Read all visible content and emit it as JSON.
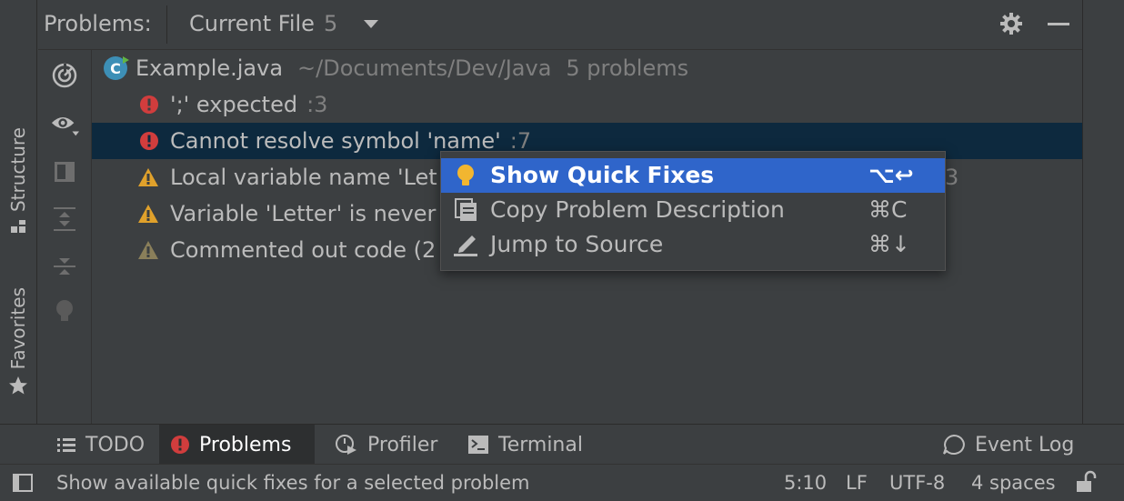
{
  "left_stripe": {
    "structure_label": "Structure",
    "favorites_label": "Favorites"
  },
  "header": {
    "title": "Problems:",
    "scope_label": "Current File",
    "scope_count": "5",
    "settings_icon": "gear-icon",
    "minimize_icon": "minimize-icon"
  },
  "toolbar": {
    "icons": [
      "autoscroll-icon",
      "eye-icon",
      "preview-icon",
      "expand-all-icon",
      "collapse-all-icon",
      "lightbulb-icon"
    ]
  },
  "tree": {
    "file": {
      "name": "Example.java",
      "path": "~/Documents/Dev/Java",
      "summary": "5 problems"
    },
    "problems": [
      {
        "severity": "error",
        "text": "';' expected",
        "line": ":3"
      },
      {
        "severity": "error",
        "text": "Cannot resolve symbol 'name'",
        "line": ":7"
      },
      {
        "severity": "warning",
        "text": "Local variable name 'Let",
        "line": "3"
      },
      {
        "severity": "warning",
        "text": "Variable 'Letter' is never"
      },
      {
        "severity": "weak-warning",
        "text": "Commented out code (2"
      }
    ]
  },
  "context_menu": {
    "items": [
      {
        "label": "Show Quick Fixes",
        "shortcut": "⌥↩",
        "icon": "lightbulb-icon"
      },
      {
        "label": "Copy Problem Description",
        "shortcut": "⌘C",
        "icon": "copy-icon"
      },
      {
        "label": "Jump to Source",
        "shortcut": "⌘↓",
        "icon": "edit-icon"
      }
    ]
  },
  "bottom_tabs": {
    "todo": "TODO",
    "problems": "Problems",
    "profiler": "Profiler",
    "terminal": "Terminal",
    "event_log": "Event Log"
  },
  "status_bar": {
    "message": "Show available quick fixes for a selected problem",
    "position": "5:10",
    "line_separator": "LF",
    "encoding": "UTF-8",
    "indent": "4 spaces"
  },
  "colors": {
    "background": "#3c3f41",
    "selection": "#0d293e",
    "menu_active": "#2f65ca",
    "error": "#d13d3d",
    "warning": "#e0a12b",
    "weak_warning": "#8a7f5a",
    "lightbulb": "#f2b630"
  }
}
